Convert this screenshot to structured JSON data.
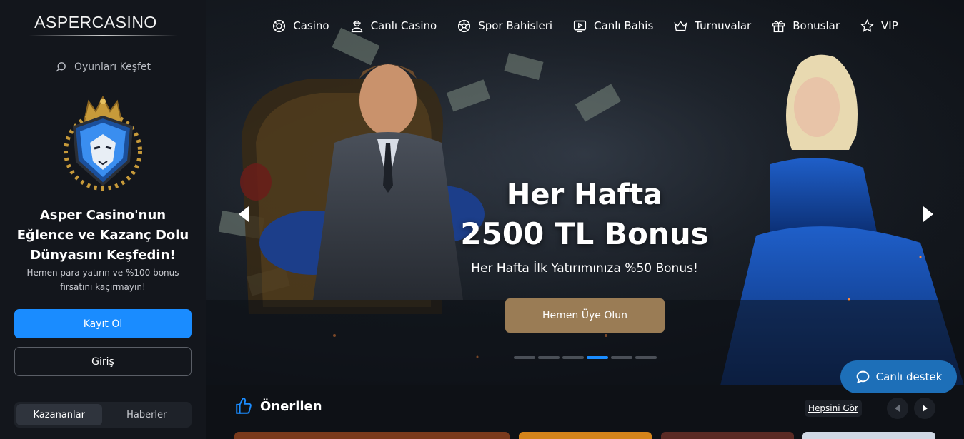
{
  "brand": {
    "logo_text": "ASPERCASINO"
  },
  "sidebar": {
    "search_placeholder": "Oyunları Keşfet",
    "title": "Asper Casino'nun Eğlence ve Kazanç Dolu Dünyasını Keşfedin!",
    "subtitle": "Hemen para yatırın ve %100 bonus fırsatını kaçırmayın!",
    "register_label": "Kayıt Ol",
    "login_label": "Giriş",
    "tabs": [
      {
        "label": "Kazananlar",
        "active": true
      },
      {
        "label": "Haberler",
        "active": false
      }
    ]
  },
  "nav": {
    "items": [
      {
        "label": "Casino",
        "icon": "chip-icon"
      },
      {
        "label": "Canlı Casino",
        "icon": "dealer-icon"
      },
      {
        "label": "Spor Bahisleri",
        "icon": "soccer-ball-icon"
      },
      {
        "label": "Canlı Bahis",
        "icon": "play-screen-icon"
      },
      {
        "label": "Turnuvalar",
        "icon": "crown-icon"
      },
      {
        "label": "Bonuslar",
        "icon": "gift-icon"
      },
      {
        "label": "VIP",
        "icon": "star-icon"
      }
    ]
  },
  "hero": {
    "title_line1": "Her Hafta",
    "title_line2": "2500 TL Bonus",
    "subtitle": "Her Hafta İlk Yatırımınıza %50 Bonus!",
    "cta_label": "Hemen Üye Olun",
    "slide_count": 6,
    "active_slide": 4
  },
  "recommended": {
    "title": "Önerilen",
    "see_all_label": "Hepsini Gör"
  },
  "support": {
    "label": "Canlı destek"
  },
  "colors": {
    "accent": "#1a8cff",
    "cta": "#9a7c55",
    "support": "#1d6fb8",
    "sidebar_bg": "#13161c"
  }
}
